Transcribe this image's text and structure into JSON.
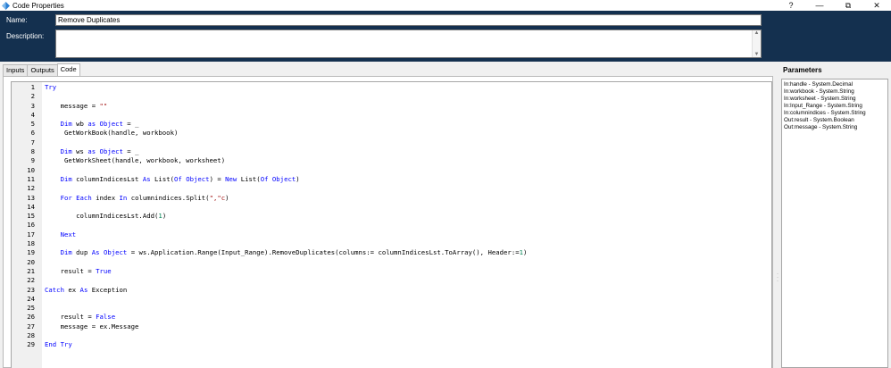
{
  "window": {
    "title": "Code Properties",
    "buttons": {
      "help": "?",
      "minimize": "—",
      "maximize": "⧉",
      "close": "✕"
    }
  },
  "form": {
    "name_label": "Name:",
    "name_value": "Remove Duplicates",
    "description_label": "Description:",
    "description_value": ""
  },
  "tabs": [
    {
      "label": "Inputs",
      "active": false
    },
    {
      "label": "Outputs",
      "active": false
    },
    {
      "label": "Code",
      "active": true
    }
  ],
  "code": {
    "lines": [
      {
        "n": "1",
        "tokens": [
          [
            "kw",
            "Try"
          ]
        ]
      },
      {
        "n": "2",
        "tokens": []
      },
      {
        "n": "3",
        "tokens": [
          [
            "t",
            "    message = "
          ],
          [
            "str",
            "\"\""
          ]
        ]
      },
      {
        "n": "4",
        "tokens": []
      },
      {
        "n": "5",
        "tokens": [
          [
            "t",
            "    "
          ],
          [
            "kw",
            "Dim"
          ],
          [
            "t",
            " wb "
          ],
          [
            "kw",
            "as"
          ],
          [
            "t",
            " "
          ],
          [
            "kw",
            "Object"
          ],
          [
            "t",
            " = _"
          ]
        ]
      },
      {
        "n": "6",
        "tokens": [
          [
            "t",
            "     GetWorkBook(handle, workbook)"
          ]
        ]
      },
      {
        "n": "7",
        "tokens": []
      },
      {
        "n": "8",
        "tokens": [
          [
            "t",
            "    "
          ],
          [
            "kw",
            "Dim"
          ],
          [
            "t",
            " ws "
          ],
          [
            "kw",
            "as"
          ],
          [
            "t",
            " "
          ],
          [
            "kw",
            "Object"
          ],
          [
            "t",
            " = _"
          ]
        ]
      },
      {
        "n": "9",
        "tokens": [
          [
            "t",
            "     GetWorkSheet(handle, workbook, worksheet)"
          ]
        ]
      },
      {
        "n": "10",
        "tokens": []
      },
      {
        "n": "11",
        "tokens": [
          [
            "t",
            "    "
          ],
          [
            "kw",
            "Dim"
          ],
          [
            "t",
            " columnIndicesLst "
          ],
          [
            "kw",
            "As"
          ],
          [
            "t",
            " List("
          ],
          [
            "kw",
            "Of"
          ],
          [
            "t",
            " "
          ],
          [
            "kw",
            "Object"
          ],
          [
            "t",
            ") = "
          ],
          [
            "kw",
            "New"
          ],
          [
            "t",
            " List("
          ],
          [
            "kw",
            "Of"
          ],
          [
            "t",
            " "
          ],
          [
            "kw",
            "Object"
          ],
          [
            "t",
            ")"
          ]
        ]
      },
      {
        "n": "12",
        "tokens": []
      },
      {
        "n": "13",
        "tokens": [
          [
            "t",
            "    "
          ],
          [
            "kw",
            "For Each"
          ],
          [
            "t",
            " index "
          ],
          [
            "kw",
            "In"
          ],
          [
            "t",
            " columnindices.Split("
          ],
          [
            "str",
            "\",\"c"
          ],
          [
            "t",
            ")"
          ]
        ]
      },
      {
        "n": "14",
        "tokens": []
      },
      {
        "n": "15",
        "tokens": [
          [
            "t",
            "        columnIndicesLst.Add("
          ],
          [
            "num",
            "1"
          ],
          [
            "t",
            ")"
          ]
        ]
      },
      {
        "n": "16",
        "tokens": []
      },
      {
        "n": "17",
        "tokens": [
          [
            "t",
            "    "
          ],
          [
            "kw",
            "Next"
          ]
        ]
      },
      {
        "n": "18",
        "tokens": []
      },
      {
        "n": "19",
        "tokens": [
          [
            "t",
            "    "
          ],
          [
            "kw",
            "Dim"
          ],
          [
            "t",
            " dup "
          ],
          [
            "kw",
            "As"
          ],
          [
            "t",
            " "
          ],
          [
            "kw",
            "Object"
          ],
          [
            "t",
            " = ws.Application.Range(Input_Range).RemoveDuplicates(columns:= columnIndicesLst.ToArray(), Header:="
          ],
          [
            "num",
            "1"
          ],
          [
            "t",
            ")"
          ]
        ]
      },
      {
        "n": "20",
        "tokens": []
      },
      {
        "n": "21",
        "tokens": [
          [
            "t",
            "    result = "
          ],
          [
            "kw",
            "True"
          ]
        ]
      },
      {
        "n": "22",
        "tokens": []
      },
      {
        "n": "23",
        "tokens": [
          [
            "kw",
            "Catch"
          ],
          [
            "t",
            " ex "
          ],
          [
            "kw",
            "As"
          ],
          [
            "t",
            " Exception"
          ]
        ]
      },
      {
        "n": "24",
        "tokens": []
      },
      {
        "n": "25",
        "tokens": []
      },
      {
        "n": "26",
        "tokens": [
          [
            "t",
            "    result = "
          ],
          [
            "kw",
            "False"
          ]
        ]
      },
      {
        "n": "27",
        "tokens": [
          [
            "t",
            "    message = ex.Message"
          ]
        ]
      },
      {
        "n": "28",
        "tokens": []
      },
      {
        "n": "29",
        "tokens": [
          [
            "kw",
            "End Try"
          ]
        ]
      }
    ]
  },
  "parameters": {
    "title": "Parameters",
    "items": [
      "In:handle - System.Decimal",
      "In:workbook - System.String",
      "In:worksheet - System.String",
      "In:Input_Range - System.String",
      "In:columnindices - System.String",
      "Out:result - System.Boolean",
      "Out:message - System.String"
    ]
  },
  "colors": {
    "header_bg": "#14304f",
    "keyword": "#0000ff",
    "string": "#a31515",
    "number": "#098658"
  }
}
